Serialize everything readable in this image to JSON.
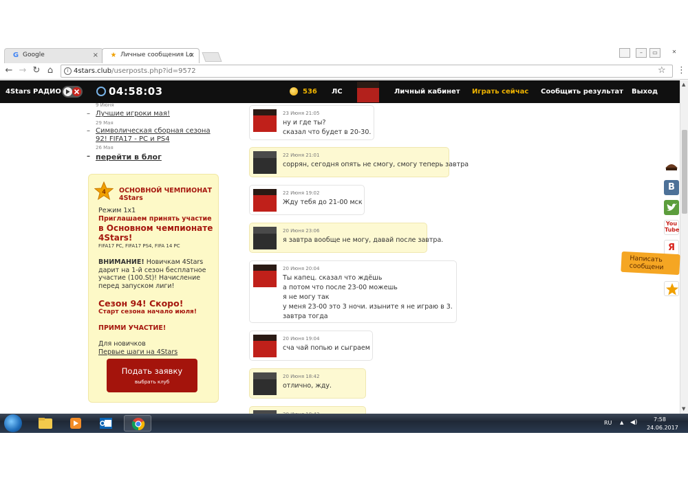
{
  "browser": {
    "tabs": [
      {
        "title": "Google",
        "active": false
      },
      {
        "title": "Личные сообщения Lo",
        "active": true
      }
    ],
    "close_glyph": "×",
    "url_domain": "4stars.club",
    "url_path": "/userposts.php?id=9572",
    "window_buttons": [
      "–",
      "▭",
      "✕"
    ]
  },
  "header": {
    "radio_label": "4Stars РАДИО",
    "time": "04:58:03",
    "coins": "536",
    "ls_label": "ЛС",
    "nav": [
      "Личный кабинет",
      "Играть сейчас",
      "Сообщить результат",
      "Выход"
    ]
  },
  "sidebar": {
    "top_date": "9 Июня",
    "blog_items": [
      {
        "title_lines": [
          "Лучшие игроки мая!"
        ],
        "date": "29 Мая"
      },
      {
        "title_lines": [
          "Символическая сборная сезона",
          "92! FIFA17 - PC и PS4"
        ],
        "date": "26 Мая"
      }
    ],
    "blog_all": "перейти в блог",
    "promo": {
      "title_lines": [
        "ОСНОВНОЙ ЧЕМПИОНАТ",
        "4Stars"
      ],
      "mode": "Режим 1x1",
      "invite": "Приглашаем принять участие",
      "champ_lines": [
        "в Основном чемпионате",
        "4Stars!"
      ],
      "platforms": "FIFA17 PC, FIFA17 PS4, FIFA 14 PC",
      "warning_bold": "ВНИМАНИЕ!",
      "warning_lines": [
        " Новичкам 4Stars",
        "дарит на 1-й сезон бесплатное",
        "участие (100.St)! Начисление",
        "перед запуском лиги!"
      ],
      "season": "Сезон 94! Скоро!",
      "season_start": "Старт сезона начало июля!",
      "join": "ПРИМИ УЧАСТИЕ!",
      "newbies": "Для новичков",
      "first_steps": "Первые шаги на 4Stars",
      "apply_main": "Подать заявку",
      "apply_sub": "выбрать клуб"
    }
  },
  "messages": [
    {
      "author": "me",
      "meta": "23 Июня 21:05",
      "text": "ну и где ты?\nсказал что будет в 20-30."
    },
    {
      "author": "them",
      "meta": "22 Июня 21:01",
      "text": "соррян, сегодня опять не смогу, смогу теперь завтра"
    },
    {
      "author": "me",
      "meta": "22 Июня 19:02",
      "text": "Жду тебя до 21-00 мск"
    },
    {
      "author": "them",
      "meta": "20 Июня 23:06",
      "text": "я завтра вообще не могу, давай после завтра."
    },
    {
      "author": "me",
      "meta": "20 Июня 20:04",
      "text": "Ты капец. сказал что ждёшь\nа потом что после 23-00 можешь\nя не могу так\nу меня 23-00 это 3 ночи. изыните я не играю в 3.\nзавтра тогда"
    },
    {
      "author": "me",
      "meta": "20 Июня 19:04",
      "text": "сча чай попью и сыграем"
    },
    {
      "author": "them",
      "meta": "20 Июня 18:42",
      "text": "отлично, жду."
    },
    {
      "author": "them",
      "meta": "20 Июня 18:42",
      "text": ""
    }
  ],
  "social": {
    "vk": "В",
    "youtube": "You Tube",
    "yandex": "Я",
    "write_lines": [
      "Написать",
      "сообщени"
    ]
  },
  "taskbar": {
    "lang": "RU",
    "time": "7:58",
    "date": "24.06.2017"
  },
  "colors": {
    "accent_red": "#a5170e",
    "gold": "#f0b400",
    "header_bg": "#101010",
    "promo_bg": "#fdf9c7"
  }
}
